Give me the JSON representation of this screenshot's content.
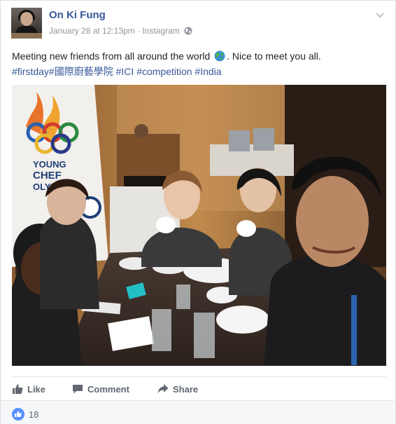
{
  "post": {
    "author": "On Ki Fung",
    "date": "January 28 at 12:13pm",
    "separator": "·",
    "source": "Instagram",
    "text_line1_part1": "Meeting new friends from all around the world",
    "text_line1_part2": ". Nice to meet you all.",
    "hashtags": {
      "tag1": "#firstday",
      "tag2": "#國際廚藝學院",
      "tag3": "#ICI",
      "tag4": "#competition",
      "tag5": "#India"
    },
    "photo_banner_text": {
      "line1": "YOUNG",
      "line2": "CHEF",
      "line3": "OLYMPIAD"
    }
  },
  "actions": {
    "like": "Like",
    "comment": "Comment",
    "share": "Share"
  },
  "footer": {
    "like_count": "18"
  },
  "colors": {
    "link": "#365899",
    "text": "#1d2129",
    "meta": "#90949c",
    "action": "#606770",
    "like_badge": "#5890ff"
  }
}
